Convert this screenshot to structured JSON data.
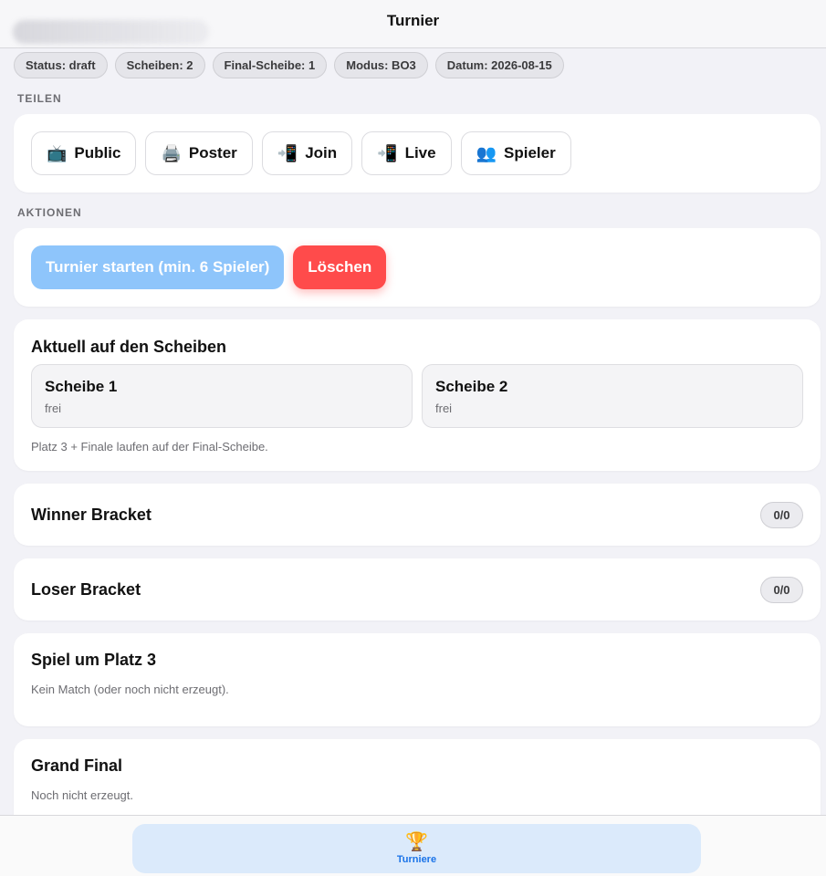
{
  "header": {
    "title": "Turnier"
  },
  "chips": [
    "Status: draft",
    "Scheiben: 2",
    "Final-Scheibe: 1",
    "Modus: BO3",
    "Datum: 2026-08-15"
  ],
  "share": {
    "section_label": "TEILEN",
    "buttons": [
      {
        "icon": "📺",
        "icon_name": "tv-icon",
        "label": "Public"
      },
      {
        "icon": "🖨️",
        "icon_name": "printer-icon",
        "label": "Poster"
      },
      {
        "icon": "📲",
        "icon_name": "phone-arrow-icon",
        "label": "Join"
      },
      {
        "icon": "📲",
        "icon_name": "phone-arrow-icon",
        "label": "Live"
      },
      {
        "icon": "👥",
        "icon_name": "people-icon",
        "label": "Spieler"
      }
    ]
  },
  "actions": {
    "section_label": "AKTIONEN",
    "start_label": "Turnier starten (min. 6 Spieler)",
    "delete_label": "Löschen"
  },
  "boards": {
    "title": "Aktuell auf den Scheiben",
    "items": [
      {
        "name": "Scheibe 1",
        "state": "frei"
      },
      {
        "name": "Scheibe 2",
        "state": "frei"
      }
    ],
    "note": "Platz 3 + Finale laufen auf der Final-Scheibe."
  },
  "winner_bracket": {
    "title": "Winner Bracket",
    "count": "0/0"
  },
  "loser_bracket": {
    "title": "Loser Bracket",
    "count": "0/0"
  },
  "third_place": {
    "title": "Spiel um Platz 3",
    "note": "Kein Match (oder noch nicht erzeugt)."
  },
  "grand_final": {
    "title": "Grand Final",
    "note": "Noch nicht erzeugt."
  },
  "tabbar": {
    "icon": "🏆",
    "icon_name": "trophy-icon",
    "label": "Turniere"
  },
  "colors": {
    "accent": "#1a73e8",
    "start_button": "#8ec5fb",
    "delete_button": "#ff4b4b"
  }
}
